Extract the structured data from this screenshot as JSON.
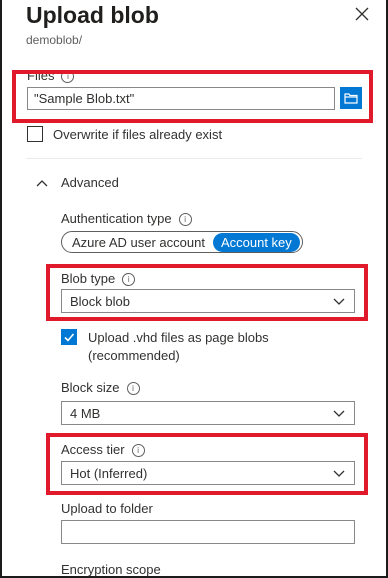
{
  "header": {
    "title": "Upload blob",
    "subtitle": "demoblob/"
  },
  "files": {
    "label": "Files",
    "value": "\"Sample Blob.txt\""
  },
  "overwrite": {
    "label": "Overwrite if files already exist",
    "checked": false
  },
  "advanced": {
    "label": "Advanced",
    "expanded": true
  },
  "auth": {
    "label": "Authentication type",
    "options": [
      "Azure AD user account",
      "Account key"
    ],
    "selected": "Account key"
  },
  "blob_type": {
    "label": "Blob type",
    "value": "Block blob"
  },
  "vhd": {
    "label_line1": "Upload .vhd files as page blobs",
    "label_line2": "(recommended)",
    "checked": true
  },
  "block_size": {
    "label": "Block size",
    "value": "4 MB"
  },
  "access_tier": {
    "label": "Access tier",
    "value": "Hot (Inferred)"
  },
  "upload_folder": {
    "label": "Upload to folder",
    "value": ""
  },
  "encryption": {
    "label": "Encryption scope"
  },
  "colors": {
    "accent": "#0078d4",
    "highlight": "#e01a2b"
  }
}
